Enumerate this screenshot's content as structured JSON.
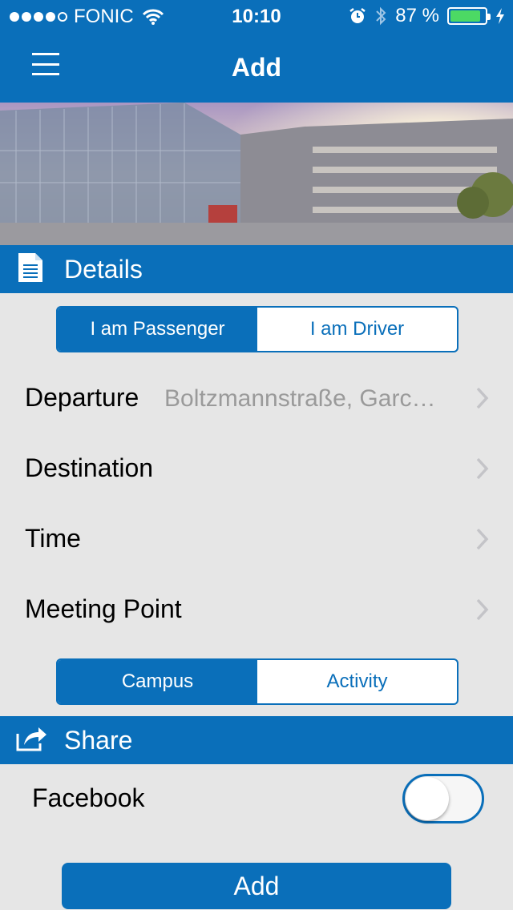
{
  "status_bar": {
    "carrier": "FONIC",
    "time": "10:10",
    "battery_percent": "87 %",
    "battery_level": 0.87,
    "icons": [
      "signal-dots",
      "wifi-icon",
      "alarm-icon",
      "bluetooth-icon",
      "battery-icon",
      "charging-bolt-icon"
    ]
  },
  "navbar": {
    "title": "Add",
    "menu_icon": "hamburger-menu-icon"
  },
  "hero_image": {
    "description_icon": "campus-building-photo"
  },
  "details_section": {
    "header": "Details",
    "icon": "document-icon",
    "role_segment": {
      "options": [
        "I am Passenger",
        "I am Driver"
      ],
      "selected": "I am Passenger"
    },
    "rows": [
      {
        "label": "Departure",
        "value": "Boltzmannstraße, Garc…"
      },
      {
        "label": "Destination",
        "value": ""
      },
      {
        "label": "Time",
        "value": ""
      },
      {
        "label": "Meeting Point",
        "value": ""
      }
    ],
    "location_segment": {
      "options": [
        "Campus",
        "Activity"
      ],
      "selected": "Campus"
    }
  },
  "share_section": {
    "header": "Share",
    "icon": "share-icon",
    "facebook_label": "Facebook",
    "facebook_enabled": false
  },
  "add_button": "Add",
  "colors": {
    "primary": "#0a6fba",
    "background": "#e6e6e6",
    "value_text": "#9a9a9a",
    "battery": "#4cd964"
  }
}
